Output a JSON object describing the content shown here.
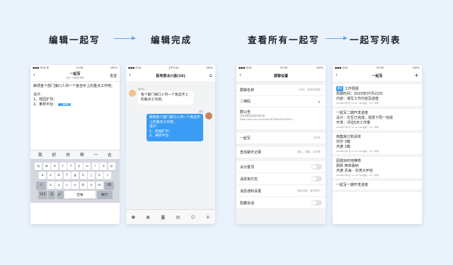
{
  "captions": {
    "edit": "编辑一起写",
    "done": "编辑完成",
    "view_all": "查看所有一起写",
    "list": "一起写列表"
  },
  "colors": {
    "accent": "#3a9cf4",
    "arrow": "#6aa9ee",
    "background": "#eaf2fb"
  },
  "phone1": {
    "status_left": "●●● GUX ☰",
    "status_center": "15:33",
    "status_right": "100%",
    "title": "一起写",
    "subtitle": "最近一次编辑 刚刚",
    "send": "发送",
    "body_line1": "麻烦各个部门接口人列一个各自手上的重点工作吧。",
    "body_line2": "设计：",
    "body_line3": "1、校园扩列：",
    "body_line4": "2、某校平台：",
    "chip": "二 编辑中",
    "candidates": [
      "我",
      "好",
      "你",
      "啊",
      "一",
      "在"
    ],
    "row1": [
      "q",
      "w",
      "e",
      "r",
      "t",
      "y",
      "u",
      "i",
      "o",
      "p"
    ],
    "row2": [
      "a",
      "s",
      "d",
      "f",
      "g",
      "h",
      "j",
      "k",
      "l"
    ],
    "row3": [
      "z",
      "x",
      "c",
      "v",
      "b",
      "n",
      "m"
    ],
    "key_num": "123",
    "key_globe": "☺",
    "key_mic": "🎤",
    "key_space": "空格",
    "key_enter": "换行",
    "key_shift": "⇧",
    "key_del": "⌫"
  },
  "phone2": {
    "status_left": "●●● GUX",
    "status_center": "上午9:41",
    "status_right": "100%",
    "title": "极地雪冰川蓝(16)",
    "menu": "☰",
    "sender_name": "陈志涛",
    "bubble_left": "各个部门接口人列一个各自手上的重点工作吧。",
    "me_name": "顾客",
    "bubble_right_1": "麻烦各个部门接口人列一个各自手上的重点工作吧。",
    "bubble_right_2": "设计：",
    "bubble_right_3": "1、校园扩列：",
    "bubble_right_4": "2、某校平台："
  },
  "phone3": {
    "status_left": "●●● GUX",
    "status_center": "09:00",
    "status_right": "100%",
    "title": "群聊设置",
    "group_name_label": "群聊名称",
    "group_name_value": "一起写 - 测试体验群",
    "qrcode_label": "二维码",
    "notice_label": "群公告",
    "notice_body": "开发进展及体验问题记录 https://docs.qq.com/sheet/DQUNeoWt4ZZWvs...",
    "yiqixie_label": "一起写",
    "yiqixie_value": "共4条",
    "history_label": "查找聊天记录",
    "history_value": "图片、视频、文件等",
    "pin_label": "设为置顶",
    "dnd_label": "消息免打扰",
    "notify_label": "消息通知设置",
    "notify_value": "接收消息，提示音开",
    "hide_label": "隐藏会话"
  },
  "phone4": {
    "status_left": "●●● GUX",
    "status_center": "09:00",
    "status_right": "100%",
    "title": "一起写",
    "add": "+",
    "cards": [
      {
        "tag": "置顶",
        "l1": "工作周报",
        "l2": "周报时间：2020年07月22日",
        "l3": "内容：填写工作内容及进度",
        "meta": "2020年7月2日 11:10  cfen最新，3人一起写"
      },
      {
        "tag": "",
        "l1": "一起写二期开发进度",
        "l2": "设计：交互已完成，视觉下周一完成",
        "l3": "开发：评估5天工作量",
        "meta": "2020年7月2日 11:10  cfen最新，3人一起写"
      },
      {
        "tag": "",
        "l1": "南集梨订购清单",
        "l2": "莎莎 3箱",
        "l3": "杰德 2箱",
        "meta": "2020年7月2日 11:10  cfen最新，3人一起写"
      },
      {
        "tag": "",
        "l1": "团建目的地推荐",
        "l2": "默默 西双版纳",
        "l3": "杰德 青海 - 甘肃大环线",
        "meta": "2020年7月2日 11:10  cfen最新，3人一起写"
      },
      {
        "tag": "",
        "l1": "一起写一期开发进度",
        "l2": "",
        "l3": "",
        "meta": ""
      }
    ]
  }
}
